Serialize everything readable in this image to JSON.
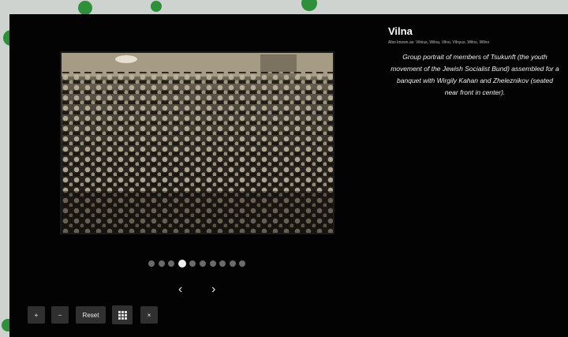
{
  "lightbox": {
    "title": "Vilna",
    "also_known_as": "Also known as: Vilnius, Wilna, Vilno, Vilnyus, Wilno, Wilno",
    "caption": "Group portrait of members of Tsukunft (the youth movement of the Jewish Socialist Bund) assembled for a banquet with Wirgily Kahan and Zheleznikov (seated near front in center).",
    "slides": {
      "total": 10,
      "active_index": 3
    },
    "nav": {
      "prev": "‹",
      "next": "›"
    },
    "controls": {
      "zoom_in": "+",
      "zoom_out": "−",
      "reset": "Reset",
      "grid": "grid-icon",
      "close": "×"
    }
  },
  "colors": {
    "backdrop": "#030303",
    "map": "#cfd3cf",
    "map_marker": "#2f8f3a",
    "dot_active": "#f0f0f0",
    "dot_inactive": "#6b6b6b",
    "button_bg": "#303030"
  }
}
